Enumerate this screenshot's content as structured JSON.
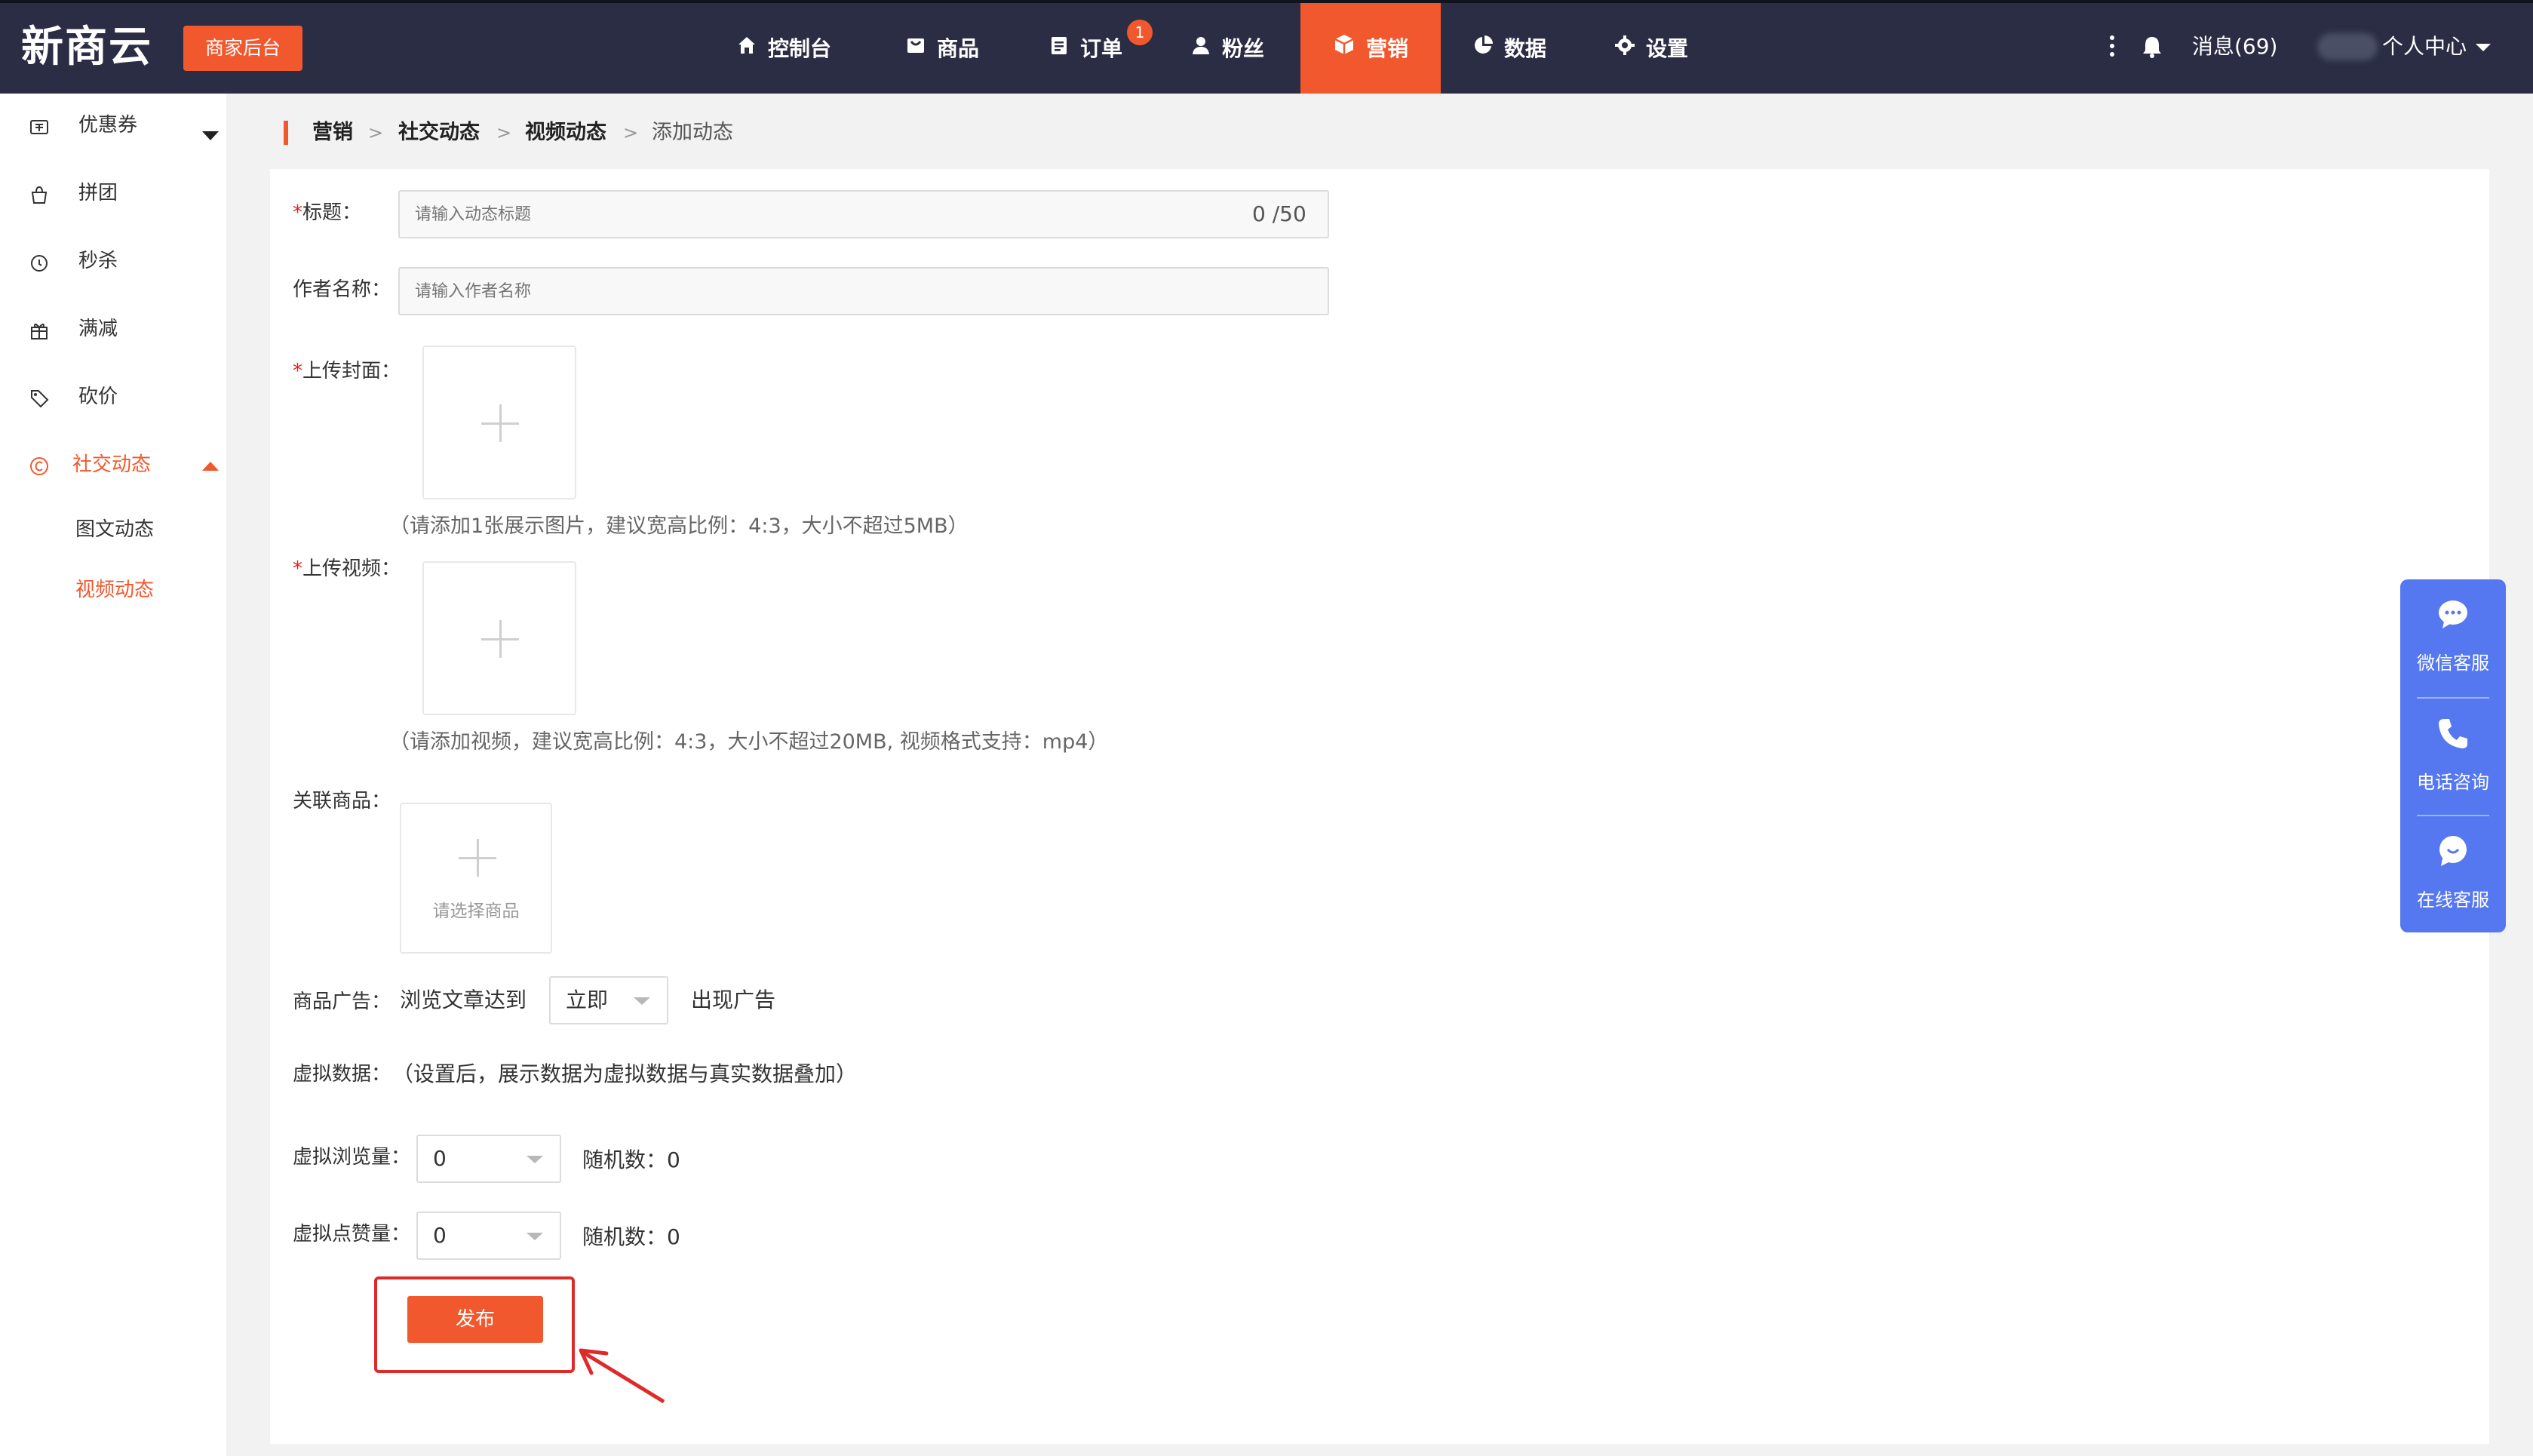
{
  "header": {
    "logo": "新商云",
    "merchant_badge": "商家后台",
    "nav": [
      {
        "label": "控制台",
        "icon": "home-icon"
      },
      {
        "label": "商品",
        "icon": "product-icon"
      },
      {
        "label": "订单",
        "icon": "order-icon",
        "badge": "1"
      },
      {
        "label": "粉丝",
        "icon": "user-icon"
      },
      {
        "label": "营销",
        "icon": "cube-icon",
        "active": true
      },
      {
        "label": "数据",
        "icon": "pie-chart-icon"
      },
      {
        "label": "设置",
        "icon": "gear-icon"
      }
    ],
    "messages": "消息(69)",
    "user_center": "个人中心"
  },
  "sidebar": {
    "items": [
      {
        "label": "优惠券",
        "icon": "coupon-icon"
      },
      {
        "label": "拼团",
        "icon": "bag-icon"
      },
      {
        "label": "秒杀",
        "icon": "timer-icon"
      },
      {
        "label": "满减",
        "icon": "gift-icon"
      },
      {
        "label": "砍价",
        "icon": "tag-icon"
      },
      {
        "label": "社交动态",
        "icon": "social-icon",
        "active": true
      }
    ],
    "sub_items": [
      {
        "label": "图文动态"
      },
      {
        "label": "视频动态",
        "active": true
      }
    ]
  },
  "breadcrumb": [
    "营销",
    "社交动态",
    "视频动态",
    "添加动态"
  ],
  "breadcrumb_sep": ">",
  "form": {
    "required_mark": "*",
    "title_label": "标题：",
    "title_placeholder": "请输入动态标题",
    "title_counter": "0 /50",
    "author_label": "作者名称：",
    "author_placeholder": "请输入作者名称",
    "cover_label": "上传封面：",
    "cover_hint": "（请添加1张展示图片，建议宽高比例：4:3，大小不超过5MB）",
    "video_label": "上传视频：",
    "video_hint": "（请添加视频，建议宽高比例：4:3，大小不超过20MB, 视频格式支持：mp4）",
    "related_label": "关联商品：",
    "related_box_text": "请选择商品",
    "ad_label": "商品广告：",
    "ad_prefix": "浏览文章达到",
    "ad_select_value": "立即",
    "ad_suffix": "出现广告",
    "virtual_label": "虚拟数据：",
    "virtual_note": "（设置后，展示数据为虚拟数据与真实数据叠加）",
    "views_label": "虚拟浏览量：",
    "views_value": "0",
    "views_random": "随机数：0",
    "likes_label": "虚拟点赞量：",
    "likes_value": "0",
    "likes_random": "随机数：0",
    "publish_button": "发布"
  },
  "float_panel": [
    {
      "label": "微信客服",
      "icon": "wechat-icon"
    },
    {
      "label": "电话咨询",
      "icon": "phone-icon"
    },
    {
      "label": "在线客服",
      "icon": "chat-bubble-icon"
    }
  ],
  "colors": {
    "accent": "#f2582d",
    "topbar": "#2a2d44",
    "float_panel": "#5577f0",
    "highlight": "#e02a2a"
  }
}
